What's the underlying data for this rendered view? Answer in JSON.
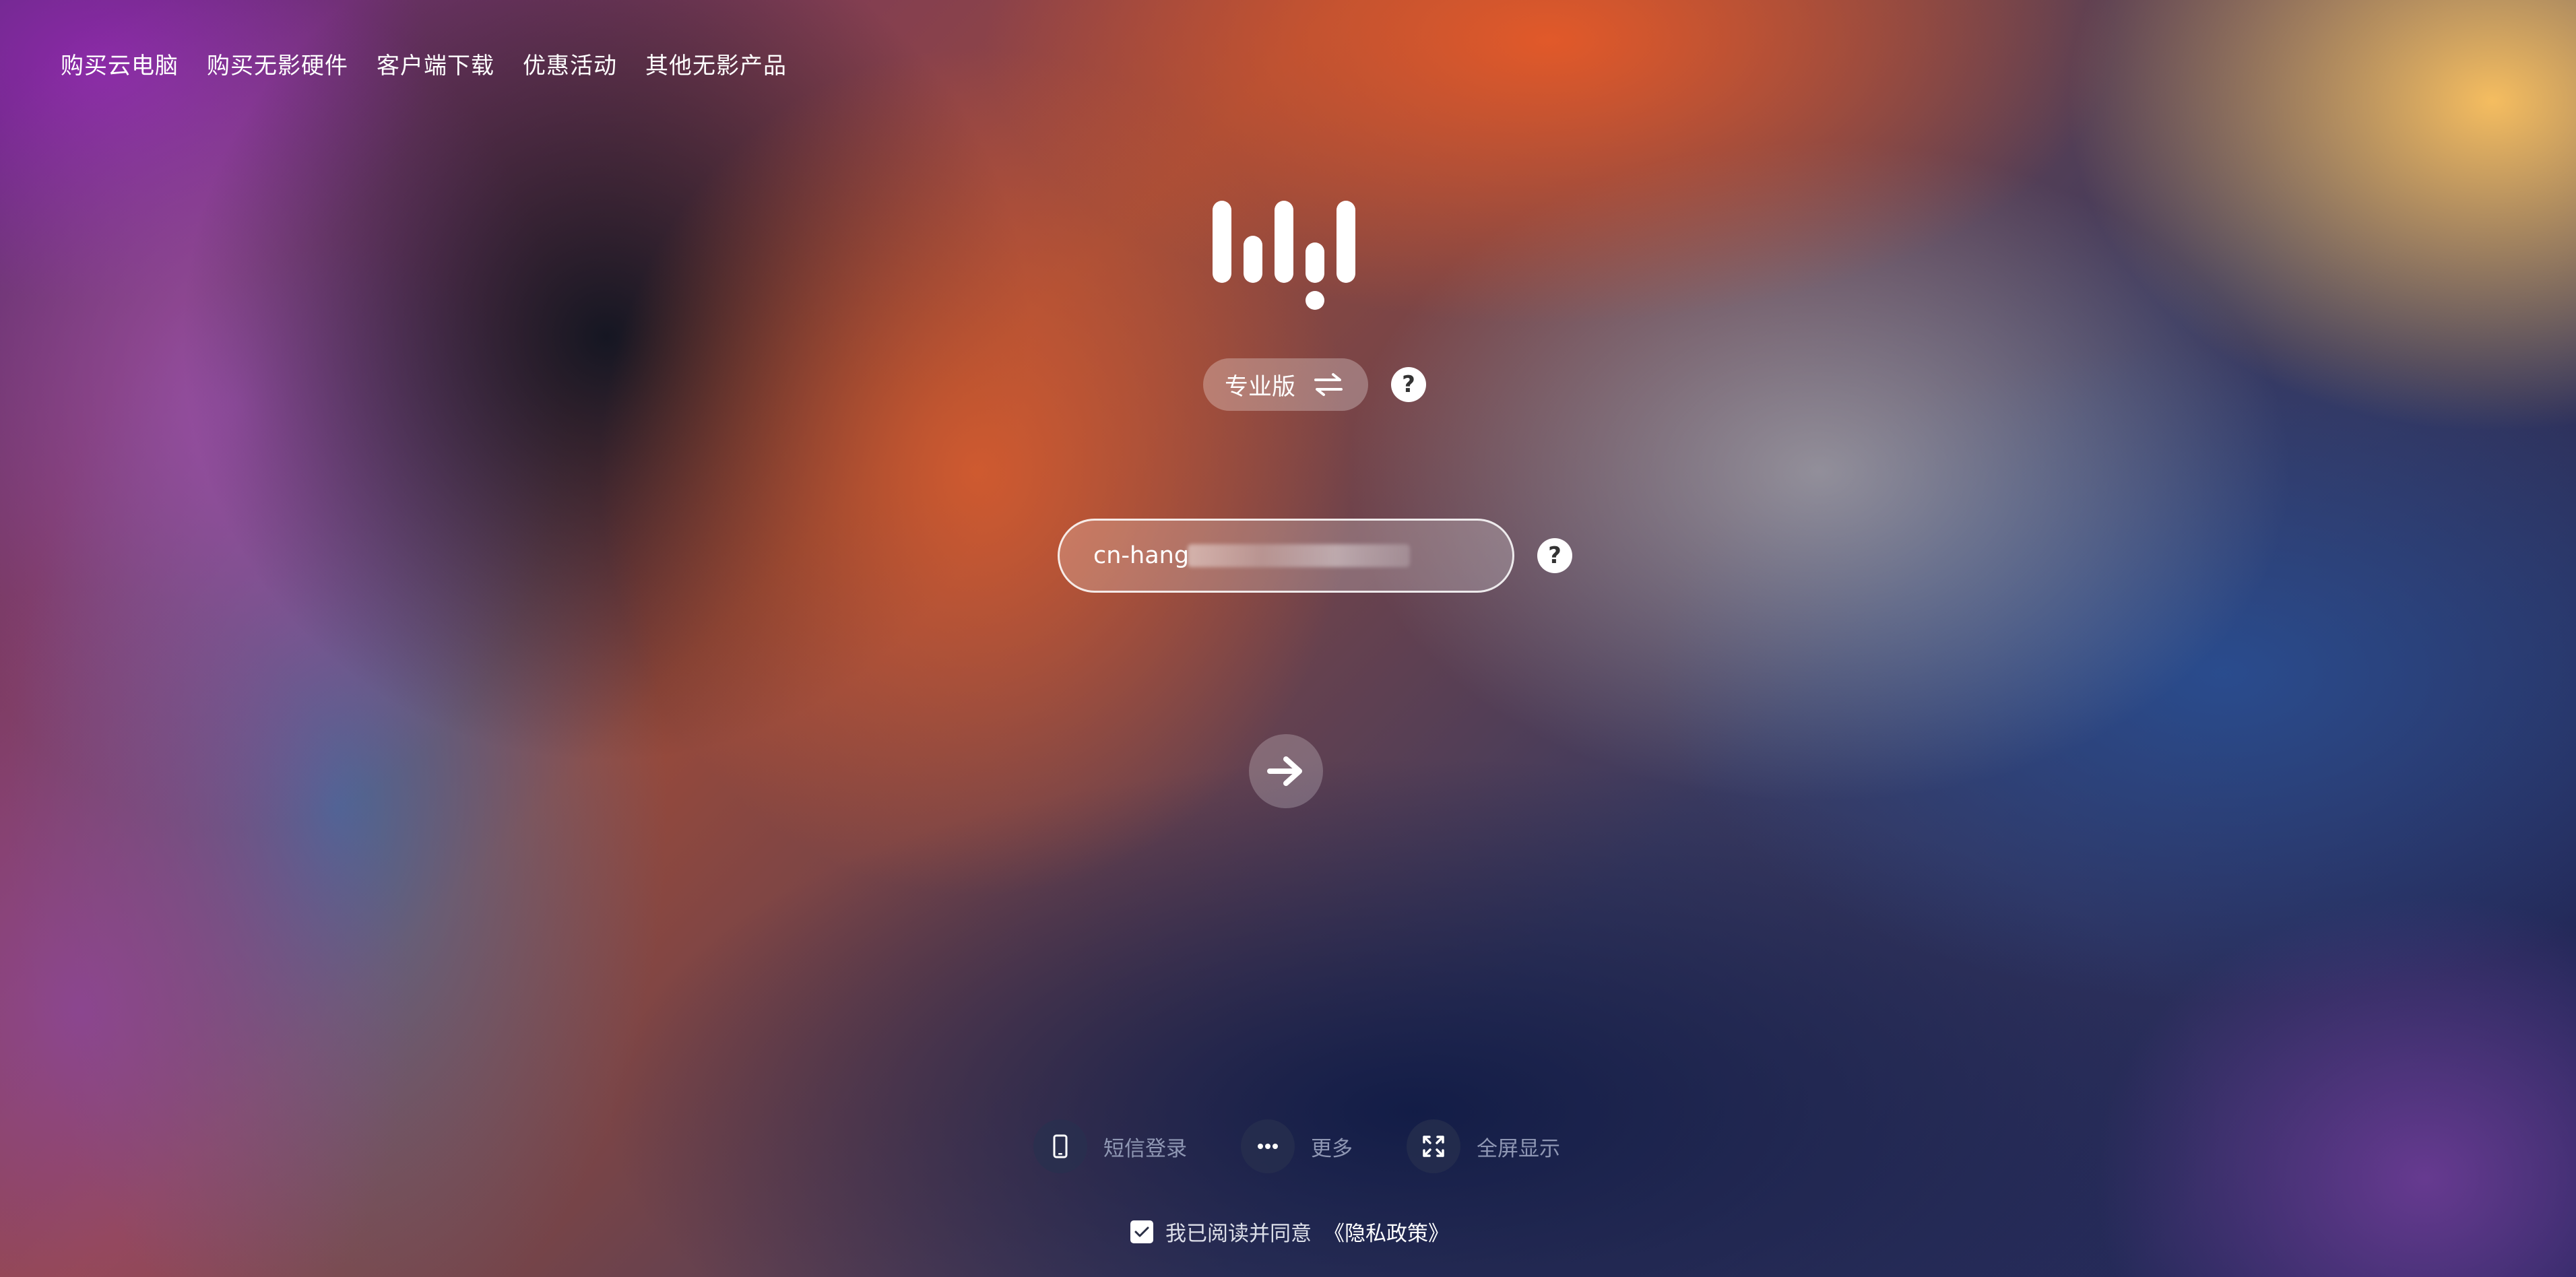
{
  "topnav": {
    "items": [
      {
        "label": "购买云电脑"
      },
      {
        "label": "购买无影硬件"
      },
      {
        "label": "客户端下载"
      },
      {
        "label": "优惠活动"
      },
      {
        "label": "其他无影产品"
      }
    ]
  },
  "logo": {
    "icon": "wuying-logo-icon"
  },
  "edition": {
    "label": "专业版",
    "switch_icon": "swap-arrows-icon",
    "help_label": "?"
  },
  "login": {
    "id_value": "cn-hangz",
    "id_help_label": "?",
    "submit_icon": "arrow-right-icon"
  },
  "actions": [
    {
      "label": "短信登录",
      "icon": "phone-icon"
    },
    {
      "label": "更多",
      "icon": "more-icon"
    },
    {
      "label": "全屏显示",
      "icon": "fullscreen-icon"
    }
  ],
  "agreement": {
    "checked": true,
    "text": "我已阅读并同意",
    "link": "《隐私政策》"
  }
}
